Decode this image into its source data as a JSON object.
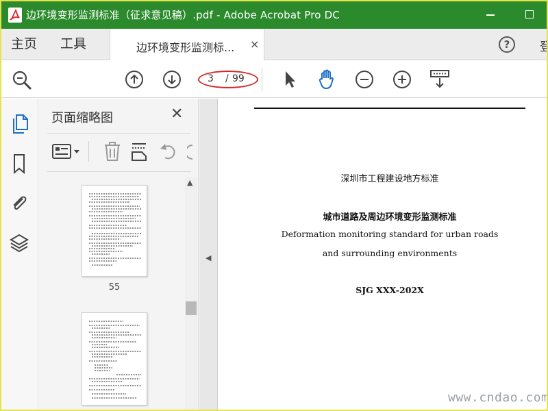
{
  "window": {
    "title": "边环境变形监测标准（征求意见稿）.pdf - Adobe Acrobat Pro DC",
    "accent_color": "#2b8a2b",
    "highlight_color": "#e4e44a"
  },
  "tabs": {
    "home_label": "主页",
    "tools_label": "工具",
    "document_tab_label": "边环境变形监测标...",
    "document_tab_close": "×",
    "help_icon": "?",
    "login_label": "登"
  },
  "toolbar": {
    "icons": [
      "search-zoom-icon",
      "page-up-icon",
      "page-down-icon",
      "select-cursor-icon",
      "hand-tool-icon",
      "zoom-out-icon",
      "zoom-in-icon",
      "keyboard-scroll-icon"
    ],
    "page_current": "3",
    "page_separator": "/",
    "page_total": "99",
    "annotation_color": "#d42a2a"
  },
  "rail": {
    "icons": [
      "page-thumbnails-icon",
      "bookmark-icon",
      "attachment-icon",
      "layers-icon"
    ]
  },
  "thumbnails_panel": {
    "title": "页面缩略图",
    "close": "✕",
    "tool_icons": [
      "thumbnail-options-icon",
      "delete-page-icon",
      "insert-page-icon",
      "undo-rotate-icon"
    ],
    "pages": [
      {
        "label": "55"
      },
      {
        "label": ""
      }
    ]
  },
  "document": {
    "line1": "深圳市工程建设地方标准",
    "line2": "城市道路及周边环境变形监测标准",
    "line3": "Deformation monitoring standard for urban roads",
    "line4": "and surrounding environments",
    "line5": "SJG XXX-202X"
  },
  "watermark": "www.cndao.com"
}
